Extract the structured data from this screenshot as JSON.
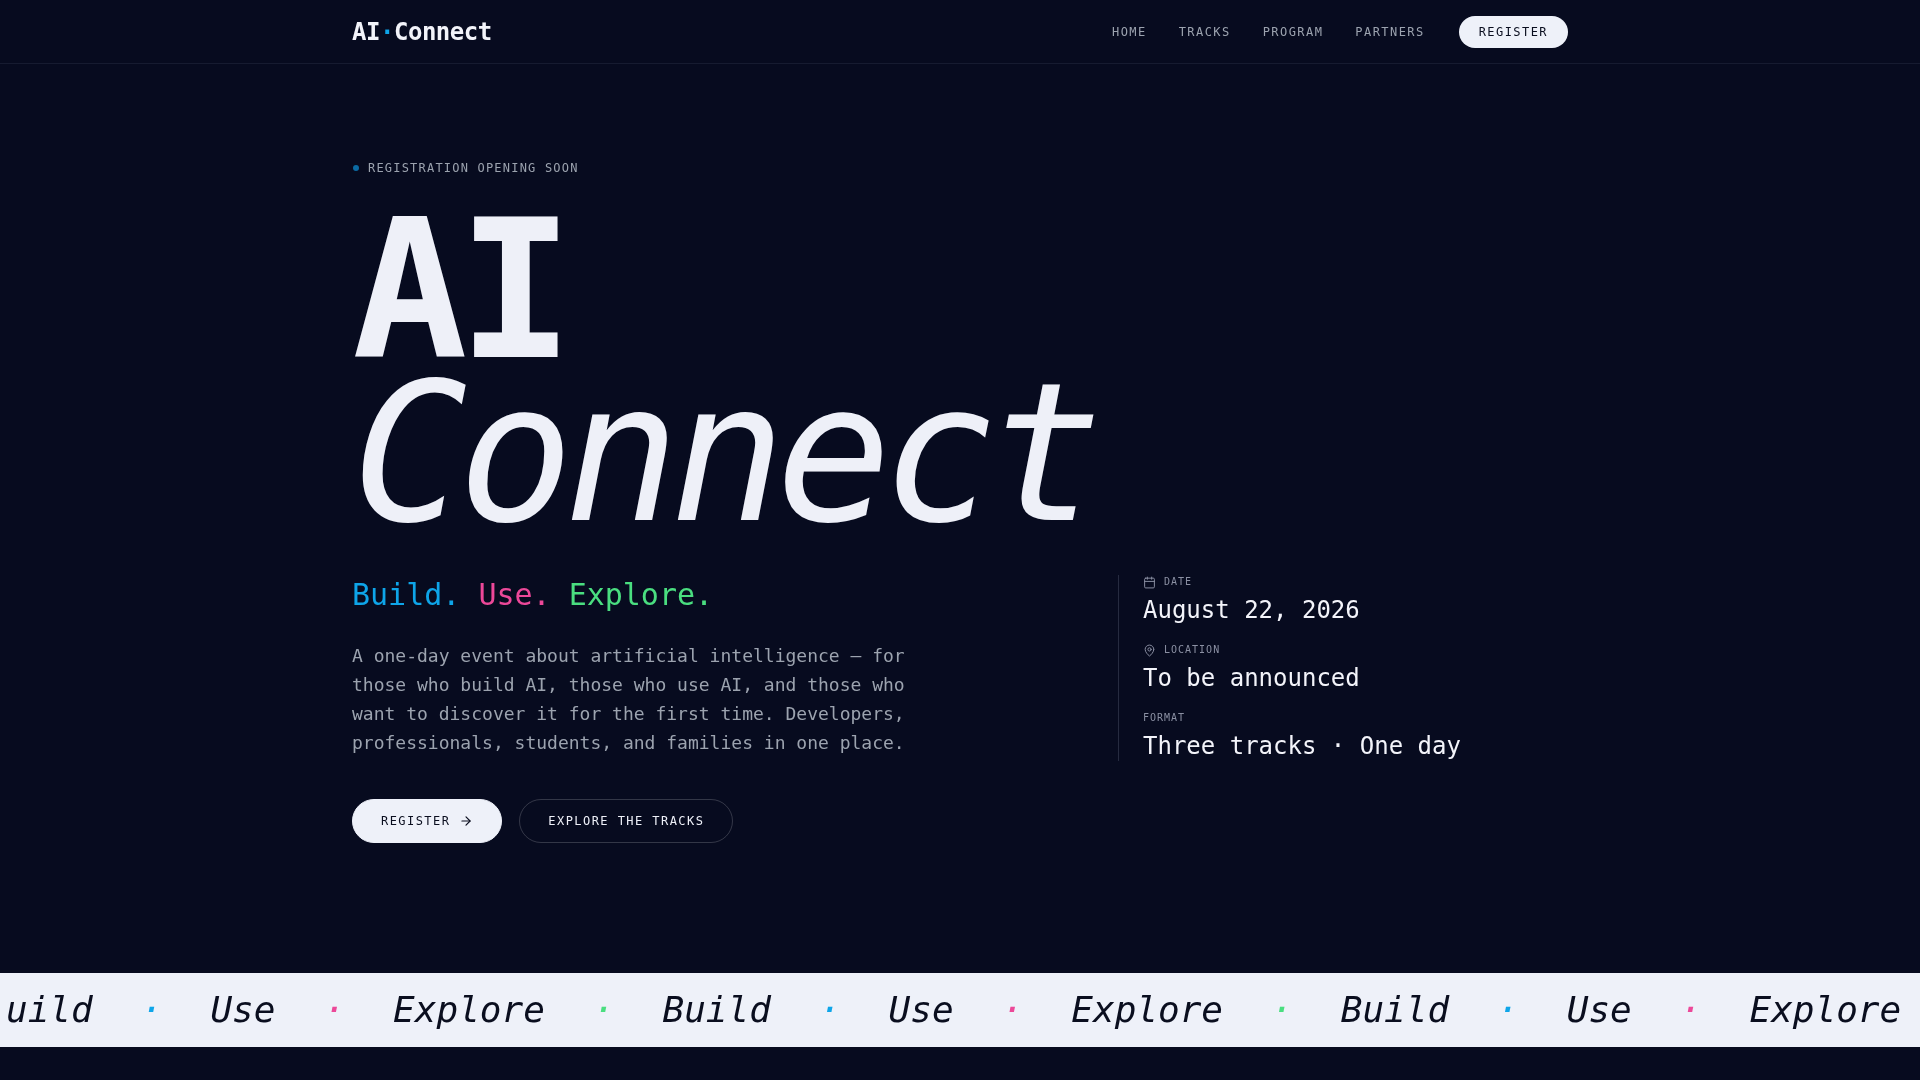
{
  "header": {
    "logo": {
      "before": "AI",
      "separator": "·",
      "after": "Connect"
    },
    "nav": [
      "HOME",
      "TRACKS",
      "PROGRAM",
      "PARTNERS"
    ],
    "cta": "REGISTER"
  },
  "hero": {
    "badge": "REGISTRATION OPENING SOON",
    "title": {
      "line_1": "AI",
      "line_2": "Connect"
    },
    "tagline": [
      {
        "text": "Build.",
        "color": "#0ea5e9"
      },
      {
        "text": "Use.",
        "color": "#ec4899"
      },
      {
        "text": "Explore.",
        "color": "#4ade80"
      }
    ],
    "description": "A one-day event about artificial intelligence — for those who build AI, those who use AI, and those who want to discover it for the first time. Developers, professionals, students, and families in one place.",
    "buttons": [
      {
        "label": "REGISTER",
        "kind": "primary"
      },
      {
        "label": "EXPLORE THE TRACKS",
        "kind": "secondary"
      }
    ],
    "details": [
      {
        "kind": "date",
        "label": "DATE",
        "value": "August 22, 2026"
      },
      {
        "kind": "location",
        "label": "LOCATION",
        "value": "To be announced"
      },
      {
        "kind": "plain",
        "label": "FORMAT",
        "value": "Three tracks · One day"
      }
    ]
  },
  "marquee": [
    {
      "kind": "word",
      "text": "uild"
    },
    {
      "kind": "dot",
      "text": "·",
      "color": "#0ea5e9"
    },
    {
      "kind": "word",
      "text": "Use"
    },
    {
      "kind": "dot",
      "text": "·",
      "color": "#ec4899"
    },
    {
      "kind": "word",
      "text": "Explore"
    },
    {
      "kind": "dot",
      "text": "·",
      "color": "#4ade80"
    },
    {
      "kind": "word",
      "text": "Build"
    },
    {
      "kind": "dot",
      "text": "·",
      "color": "#0ea5e9"
    },
    {
      "kind": "word",
      "text": "Use"
    },
    {
      "kind": "dot",
      "text": "·",
      "color": "#ec4899"
    },
    {
      "kind": "word",
      "text": "Explore"
    },
    {
      "kind": "dot",
      "text": "·",
      "color": "#4ade80"
    },
    {
      "kind": "word",
      "text": "Build"
    },
    {
      "kind": "dot",
      "text": "·",
      "color": "#0ea5e9"
    },
    {
      "kind": "word",
      "text": "Use"
    },
    {
      "kind": "dot",
      "text": "·",
      "color": "#ec4899"
    },
    {
      "kind": "word",
      "text": "Explore"
    }
  ]
}
